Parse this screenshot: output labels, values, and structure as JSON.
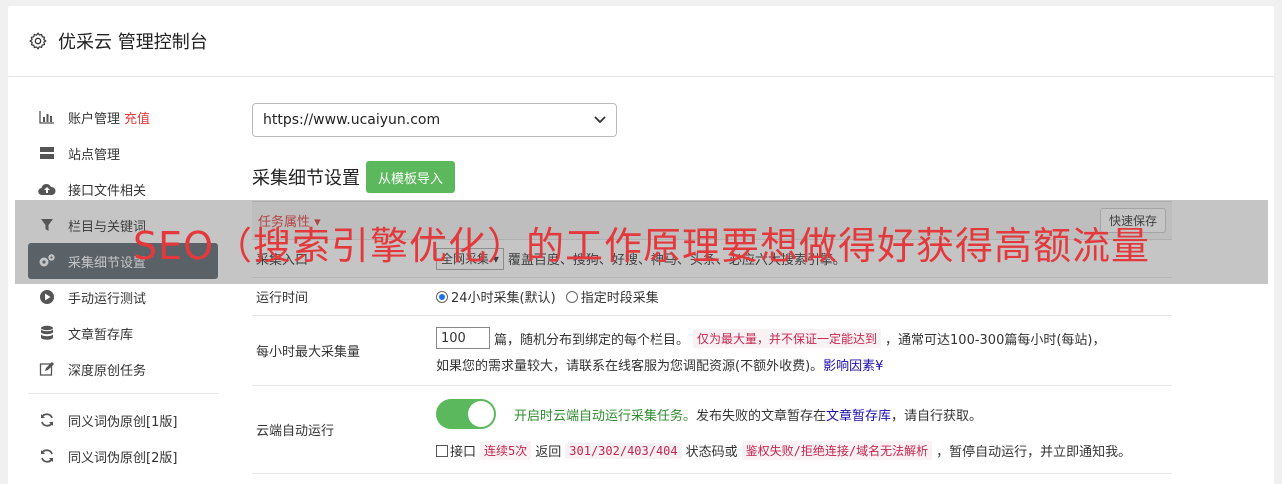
{
  "header": {
    "title": "优采云 管理控制台",
    "icon": "gear-icon"
  },
  "sidebar": {
    "items": [
      {
        "label": "账户管理",
        "extra": "充值",
        "icon": "bar-chart-icon"
      },
      {
        "label": "站点管理",
        "icon": "server-icon"
      },
      {
        "label": "接口文件相关",
        "icon": "cloud-upload-icon"
      },
      {
        "label": "栏目与关键词",
        "icon": "filter-icon"
      },
      {
        "label": "采集细节设置",
        "icon": "gears-icon",
        "active": true
      },
      {
        "label": "手动运行测试",
        "icon": "play-circle-icon"
      },
      {
        "label": "文章暂存库",
        "icon": "database-icon"
      },
      {
        "label": "深度原创任务",
        "icon": "edit-icon"
      }
    ],
    "items2": [
      {
        "label": "同义词伪原创[1版]",
        "icon": "refresh-icon"
      },
      {
        "label": "同义词伪原创[2版]",
        "icon": "refresh-icon"
      }
    ]
  },
  "main": {
    "site_select": "https://www.ucaiyun.com",
    "section_title": "采集细节设置",
    "import_button": "从模板导入",
    "tab_label": "任务属性",
    "save_button": "快速保存",
    "rows": {
      "source": {
        "label": "采集入口",
        "select": "全网采集",
        "desc": "覆盖百度、搜狗、好搜、神马、头条、必应六大搜索引擎。"
      },
      "runtime": {
        "label": "运行时间",
        "opt1": "24小时采集(默认)",
        "opt2": "指定时段采集"
      },
      "max": {
        "label": "每小时最大采集量",
        "value": "100",
        "t1": "篇，随机分布到绑定的每个栏目。",
        "code": "仅为最大量，并不保证一定能达到",
        "t2": "，通常可达100-300篇每小时(每站)，",
        "t3": "如果您的需求量较大，请联系在线客服为您调配资源(不额外收费)。",
        "link": "影响因素"
      },
      "cloud": {
        "label": "云端自动运行",
        "t1": "开启时云端自动运行采集任务。",
        "t2": "发布失败的文章暂存在",
        "link": "文章暂存库",
        "t3": "，请自行获取。",
        "c1": "接口",
        "code1": "连续5次",
        "c2": "返回",
        "code2": "301/302/403/404",
        "c3": "状态码或",
        "code3": "鉴权失败/拒绝连接/域名无法解析",
        "c4": "，暂停自动运行，并立即通知我。"
      }
    }
  },
  "overlay": {
    "text": "SEO（搜索引擎优化）的工作原理要想做得好获得高额流量"
  },
  "colors": {
    "accent_green": "#5cb85c",
    "red": "#e4393c",
    "active_nav": "#5b6770"
  }
}
